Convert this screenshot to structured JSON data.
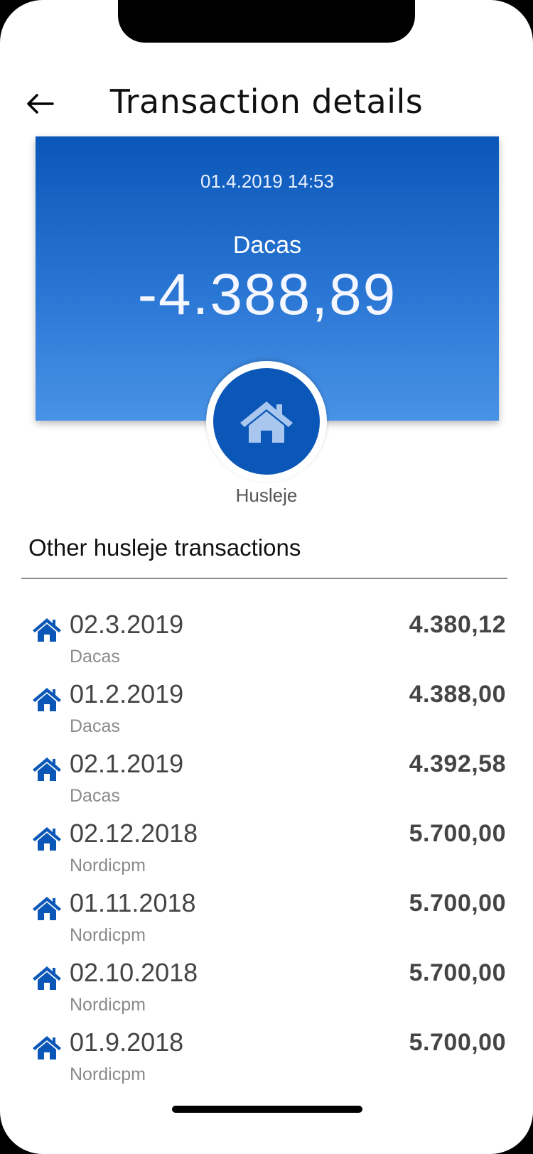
{
  "header": {
    "title": "Transaction details",
    "back_icon": "arrow-left-icon"
  },
  "transaction": {
    "datetime": "01.4.2019 14:53",
    "merchant": "Dacas",
    "amount": "-4.388,89",
    "category": "Husleje",
    "category_icon": "home-icon"
  },
  "section": {
    "title": "Other husleje transactions"
  },
  "other_transactions": [
    {
      "date": "02.3.2019",
      "merchant": "Dacas",
      "amount": "4.380,12"
    },
    {
      "date": "01.2.2019",
      "merchant": "Dacas",
      "amount": "4.388,00"
    },
    {
      "date": "02.1.2019",
      "merchant": "Dacas",
      "amount": "4.392,58"
    },
    {
      "date": "02.12.2018",
      "merchant": "Nordicpm",
      "amount": "5.700,00"
    },
    {
      "date": "01.11.2018",
      "merchant": "Nordicpm",
      "amount": "5.700,00"
    },
    {
      "date": "02.10.2018",
      "merchant": "Nordicpm",
      "amount": "5.700,00"
    },
    {
      "date": "01.9.2018",
      "merchant": "Nordicpm",
      "amount": "5.700,00"
    }
  ],
  "colors": {
    "brand_blue": "#0a57b8",
    "hero_gradient_end": "#4893e6",
    "row_icon": "#0a57b8"
  }
}
